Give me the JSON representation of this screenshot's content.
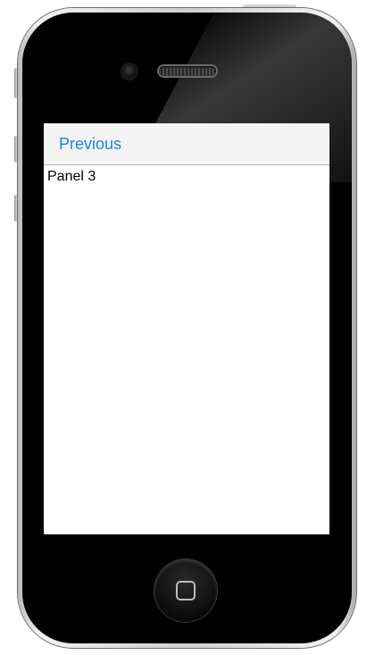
{
  "navbar": {
    "previous_label": "Previous"
  },
  "panel": {
    "label": "Panel 3"
  },
  "colors": {
    "accent": "#1a82e8",
    "navbar_bg": "#f4f4f4",
    "screen_bg": "#ffffff",
    "device_body": "#000000"
  },
  "icons": {
    "home": "home-button-icon",
    "camera": "front-camera-icon",
    "speaker": "earpiece-speaker-icon"
  }
}
